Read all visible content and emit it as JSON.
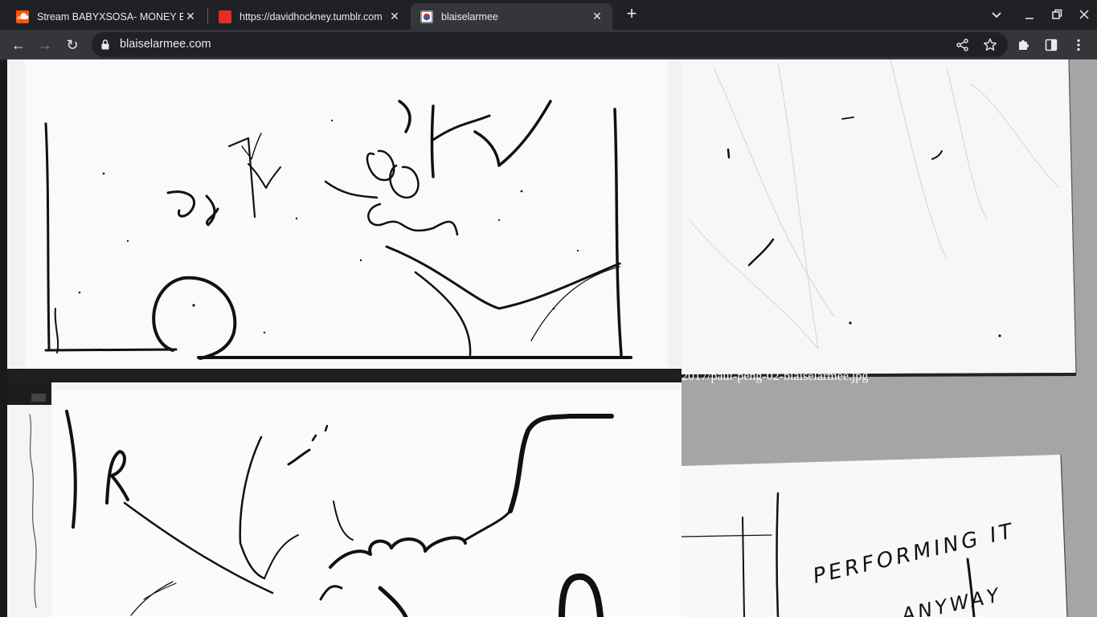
{
  "tabs": [
    {
      "title": "Stream BABYXSOSA- MONEY BA",
      "favicon": "soundcloud-icon",
      "active": false
    },
    {
      "title": "https://davidhockney.tumblr.com",
      "favicon": "tumblr-icon",
      "active": false
    },
    {
      "title": "blaiselarmee",
      "favicon": "site-icon",
      "active": true
    }
  ],
  "tab_close_glyph": "✕",
  "new_tab_glyph": "+",
  "toolbar": {
    "url": "blaiselarmee.com",
    "back_glyph": "←",
    "forward_glyph": "→",
    "reload_glyph": "↻"
  },
  "content": {
    "image_caption": "2017/paul-peng-02-blaiselarmee.jpg",
    "drawing_text_top": "PERFORMING IT",
    "drawing_text_bottom": "ANYWAY"
  },
  "colors": {
    "tabstrip_bg": "#202124",
    "toolbar_bg": "#35363a",
    "page_bg": "#a5a5a5",
    "soundcloud": "#ff5500",
    "tumblr_favicon": "#e52d27"
  }
}
